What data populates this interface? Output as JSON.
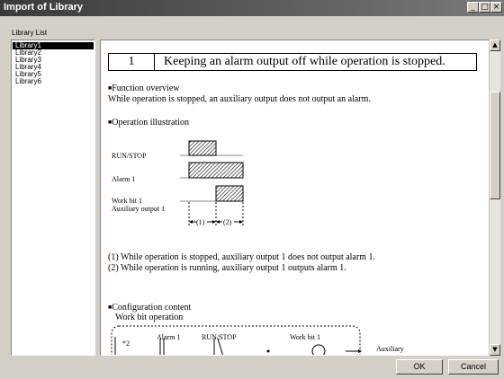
{
  "window": {
    "title": "Import of Library",
    "controls": [
      "_",
      "□",
      "×"
    ]
  },
  "library_list": {
    "label": "Library List",
    "items": [
      "Library1",
      "Library2",
      "Library3",
      "Library4",
      "Library5",
      "Library6"
    ],
    "selected": "Library1"
  },
  "content": {
    "number": "1",
    "heading": "Keeping an alarm output off while operation is stopped.",
    "function_overview_title": "Function overview",
    "function_overview_text": "While operation is stopped, an auxiliary output does not output an alarm.",
    "operation_illustration_title": "Operation illustration",
    "timing": {
      "run_stop": "RUN/STOP",
      "alarm": "Alarm 1",
      "work_bit": "Work bit 1",
      "aux_output": "Auxiliary output 1",
      "mark1": "(1)",
      "mark2": "(2)"
    },
    "note1": "(1) While operation is stopped, auxiliary output 1 does not output alarm 1.",
    "note2": "(2) While operation is running, auxiliary output 1 outputs alarm 1.",
    "configuration_title": "Configuration content",
    "configuration_sub": "Work bit operation",
    "ladder": {
      "marker": "*2",
      "alarm": "Alarm 1",
      "run_stop": "RUN/STOP",
      "work_bit": "Work bit 1",
      "aux": "Auxiliary"
    }
  },
  "buttons": {
    "ok": "OK",
    "cancel": "Cancel"
  },
  "scrollbar": {
    "up": "▲",
    "down": "▼"
  }
}
